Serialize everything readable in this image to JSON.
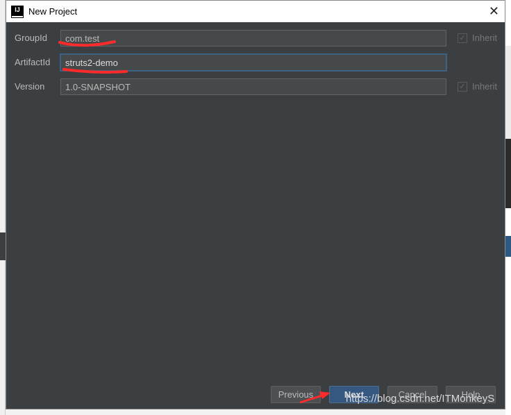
{
  "window": {
    "title": "New Project",
    "close_icon": "close-icon",
    "logo_text": "IJ"
  },
  "form": {
    "group_id": {
      "label": "GroupId",
      "value": "com.test",
      "inherit_label": "Inherit",
      "inherit_checked": true
    },
    "artifact_id": {
      "label": "ArtifactId",
      "value": "struts2-demo"
    },
    "version": {
      "label": "Version",
      "value": "1.0-SNAPSHOT",
      "inherit_label": "Inherit",
      "inherit_checked": true
    }
  },
  "buttons": {
    "previous": "Previous",
    "next": "Next",
    "cancel": "Cancel",
    "help": "Help"
  },
  "watermark": "https://blog.csdn.net/ITMonkeyS",
  "colors": {
    "dialog_bg": "#3c3f41",
    "primary_button": "#365880",
    "annotation": "#ff2a2a"
  }
}
